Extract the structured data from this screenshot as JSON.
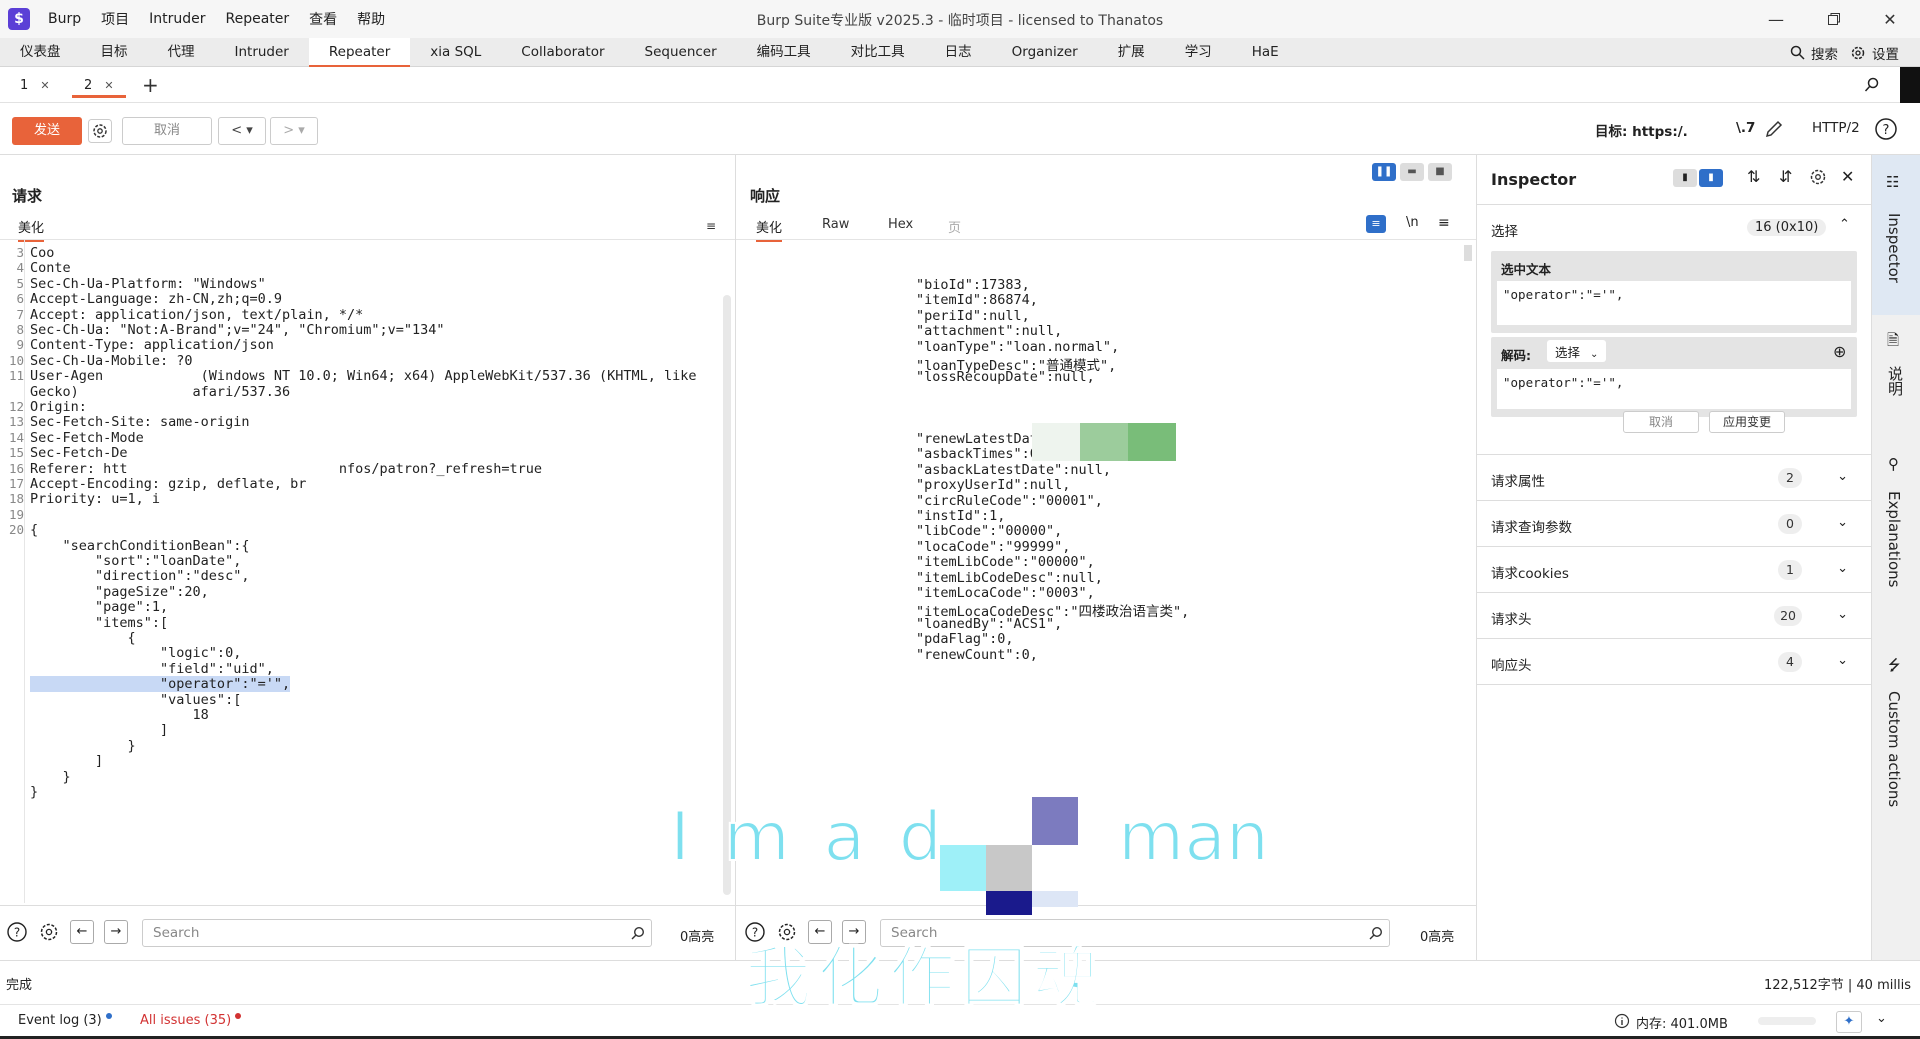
{
  "titlebar": {
    "logo": "$",
    "menu": [
      "Burp",
      "项目",
      "Intruder",
      "Repeater",
      "查看",
      "帮助"
    ],
    "title": "Burp Suite专业版  v2025.3 - 临时项目 - licensed to Thanatos"
  },
  "main_tabs": [
    "仪表盘",
    "目标",
    "代理",
    "Intruder",
    "Repeater",
    "xia SQL",
    "Collaborator",
    "Sequencer",
    "编码工具",
    "对比工具",
    "日志",
    "Organizer",
    "扩展",
    "学习",
    "HaE"
  ],
  "main_tabs_right": {
    "search": "搜索",
    "settings": "设置"
  },
  "repeater_tabs": [
    {
      "label": "1"
    },
    {
      "label": "2"
    }
  ],
  "toolbar": {
    "send": "发送",
    "cancel": "取消",
    "target_label": "目标: https:/.",
    "target_tail": "\\.7",
    "http_version": "HTTP/2"
  },
  "request": {
    "title": "请求",
    "tab": "美化",
    "lines": [
      {
        "n": "3",
        "t": "Coo"
      },
      {
        "n": "4",
        "t": "Conte"
      },
      {
        "n": "5",
        "t": "Sec-Ch-Ua-Platform: \"Windows\""
      },
      {
        "n": "6",
        "t": "Accept-Language: zh-CN,zh;q=0.9"
      },
      {
        "n": "7",
        "t": "Accept: application/json, text/plain, */*"
      },
      {
        "n": "8",
        "t": "Sec-Ch-Ua: \"Not:A-Brand\";v=\"24\", \"Chromium\";v=\"134\""
      },
      {
        "n": "9",
        "t": "Content-Type: application/json"
      },
      {
        "n": "10",
        "t": "Sec-Ch-Ua-Mobile: ?0"
      },
      {
        "n": "11",
        "t": "User-Agen            (Windows NT 10.0; Win64; x64) AppleWebKit/537.36 (KHTML, like"
      },
      {
        "n": "",
        "t": "Gecko)              afari/537.36"
      },
      {
        "n": "12",
        "t": "Origin:"
      },
      {
        "n": "13",
        "t": "Sec-Fetch-Site: same-origin"
      },
      {
        "n": "14",
        "t": "Sec-Fetch-Mode"
      },
      {
        "n": "15",
        "t": "Sec-Fetch-De"
      },
      {
        "n": "16",
        "t": "Referer: htt                          nfos/patron?_refresh=true"
      },
      {
        "n": "17",
        "t": "Accept-Encoding: gzip, deflate, br"
      },
      {
        "n": "18",
        "t": "Priority: u=1, i"
      },
      {
        "n": "19",
        "t": ""
      },
      {
        "n": "20",
        "t": "{"
      },
      {
        "n": "",
        "t": "    \"searchConditionBean\":{"
      },
      {
        "n": "",
        "t": "        \"sort\":\"loanDate\","
      },
      {
        "n": "",
        "t": "        \"direction\":\"desc\","
      },
      {
        "n": "",
        "t": "        \"pageSize\":20,"
      },
      {
        "n": "",
        "t": "        \"page\":1,"
      },
      {
        "n": "",
        "t": "        \"items\":["
      },
      {
        "n": "",
        "t": "            {"
      },
      {
        "n": "",
        "t": "                \"logic\":0,"
      },
      {
        "n": "",
        "t": "                \"field\":\"uid\","
      },
      {
        "n": "",
        "t": "                \"operator\":\"='\","
      },
      {
        "n": "",
        "t": "                \"values\":["
      },
      {
        "n": "",
        "t": "                    18"
      },
      {
        "n": "",
        "t": "                ]"
      },
      {
        "n": "",
        "t": "            }"
      },
      {
        "n": "",
        "t": "        ]"
      },
      {
        "n": "",
        "t": "    }"
      },
      {
        "n": "",
        "t": "}"
      }
    ],
    "search_placeholder": "Search",
    "highlight": "0高亮"
  },
  "response": {
    "title": "响应",
    "tabs": [
      "美化",
      "Raw",
      "Hex",
      "页"
    ],
    "lines": [
      "\"bioId\":17383,",
      "\"itemId\":86874,",
      "\"periId\":null,",
      "\"attachment\":null,",
      "\"loanType\":\"loan.normal\",",
      "\"loanTypeDesc\":\"普通模式\",",
      "\"lossRecoupDate\":null,",
      "",
      "",
      "",
      "\"renewLatestDate\":null,",
      "\"asbackTimes\":0,",
      "\"asbackLatestDate\":null,",
      "\"proxyUserId\":null,",
      "\"circRuleCode\":\"00001\",",
      "\"instId\":1,",
      "\"libCode\":\"00000\",",
      "\"locaCode\":\"99999\",",
      "\"itemLibCode\":\"00000\",",
      "\"itemLibCodeDesc\":null,",
      "\"itemLocaCode\":\"0003\",",
      "\"itemLocaCodeDesc\":\"四楼政治语言类\",",
      "\"loanedBy\":\"ACS1\",",
      "\"pdaFlag\":0,",
      "\"renewCount\":0,"
    ],
    "search_placeholder": "Search",
    "highlight": "0高亮"
  },
  "inspector": {
    "title": "Inspector",
    "selection_label": "选择",
    "selection_count": "16 (0x10)",
    "selected_text_label": "选中文本",
    "selected_text": "\"operator\":\"='\",",
    "decode_label": "解码:",
    "decode_select": "选择",
    "decoded_text": "\"operator\":\"='\",",
    "cancel": "取消",
    "apply": "应用变更",
    "sections": [
      {
        "label": "请求属性",
        "count": "2"
      },
      {
        "label": "请求查询参数",
        "count": "0"
      },
      {
        "label": "请求cookies",
        "count": "1"
      },
      {
        "label": "请求头",
        "count": "20"
      },
      {
        "label": "响应头",
        "count": "4"
      }
    ]
  },
  "sidebar": {
    "inspector": "Inspector",
    "notes": "说明",
    "explanations": "Explanations",
    "custom": "Custom actions"
  },
  "overlay": {
    "left": "I  m  a  d",
    "right": "man",
    "bottom": "我化作囚魂"
  },
  "status": {
    "done": "完成",
    "bytes": "122,512字节 | 40 millis",
    "event_log": "Event log (3)",
    "issues": "All issues (35)",
    "memory": "内存: 401.0MB"
  },
  "colors": {
    "accent": "#e8633a",
    "brand": "#5b3fd6",
    "overlay_text": "#7ee0ef",
    "issue_red": "#d23232"
  }
}
